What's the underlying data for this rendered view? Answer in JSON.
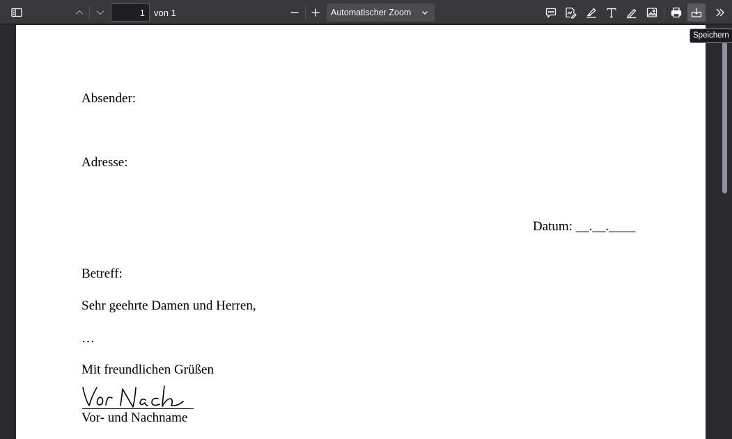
{
  "toolbar": {
    "page_number": "1",
    "page_count": "von 1",
    "zoom_value": "Automatischer Zoom",
    "tooltip": "Speichern"
  },
  "icons": {
    "sidebar": "sidebar-toggle-icon",
    "prev": "arrow-up-icon",
    "next": "arrow-down-icon",
    "zoom_out": "minus-icon",
    "zoom_in": "plus-icon",
    "comment": "comment-icon",
    "signature": "signature-icon",
    "highlight": "highlighter-icon",
    "text": "text-icon",
    "draw": "pen-icon",
    "image": "image-icon",
    "print": "printer-icon",
    "save": "save-download-icon",
    "more": "double-chevron-right-icon"
  },
  "document": {
    "sender_label": "Absender:",
    "address_label": "Adresse:",
    "date_label": "Datum: __.__.____",
    "subject_label": "Betreff:",
    "salutation": "Sehr geehrte Damen und Herren,",
    "ellipsis": "…",
    "closing": "Mit freundlichen Grüßen",
    "name_caption": "Vor- und Nachname"
  },
  "colors": {
    "toolbar_bg": "#38383d",
    "viewer_bg": "#2a2a2e",
    "page_bg": "#ffffff",
    "icon": "#f9f9fa"
  }
}
